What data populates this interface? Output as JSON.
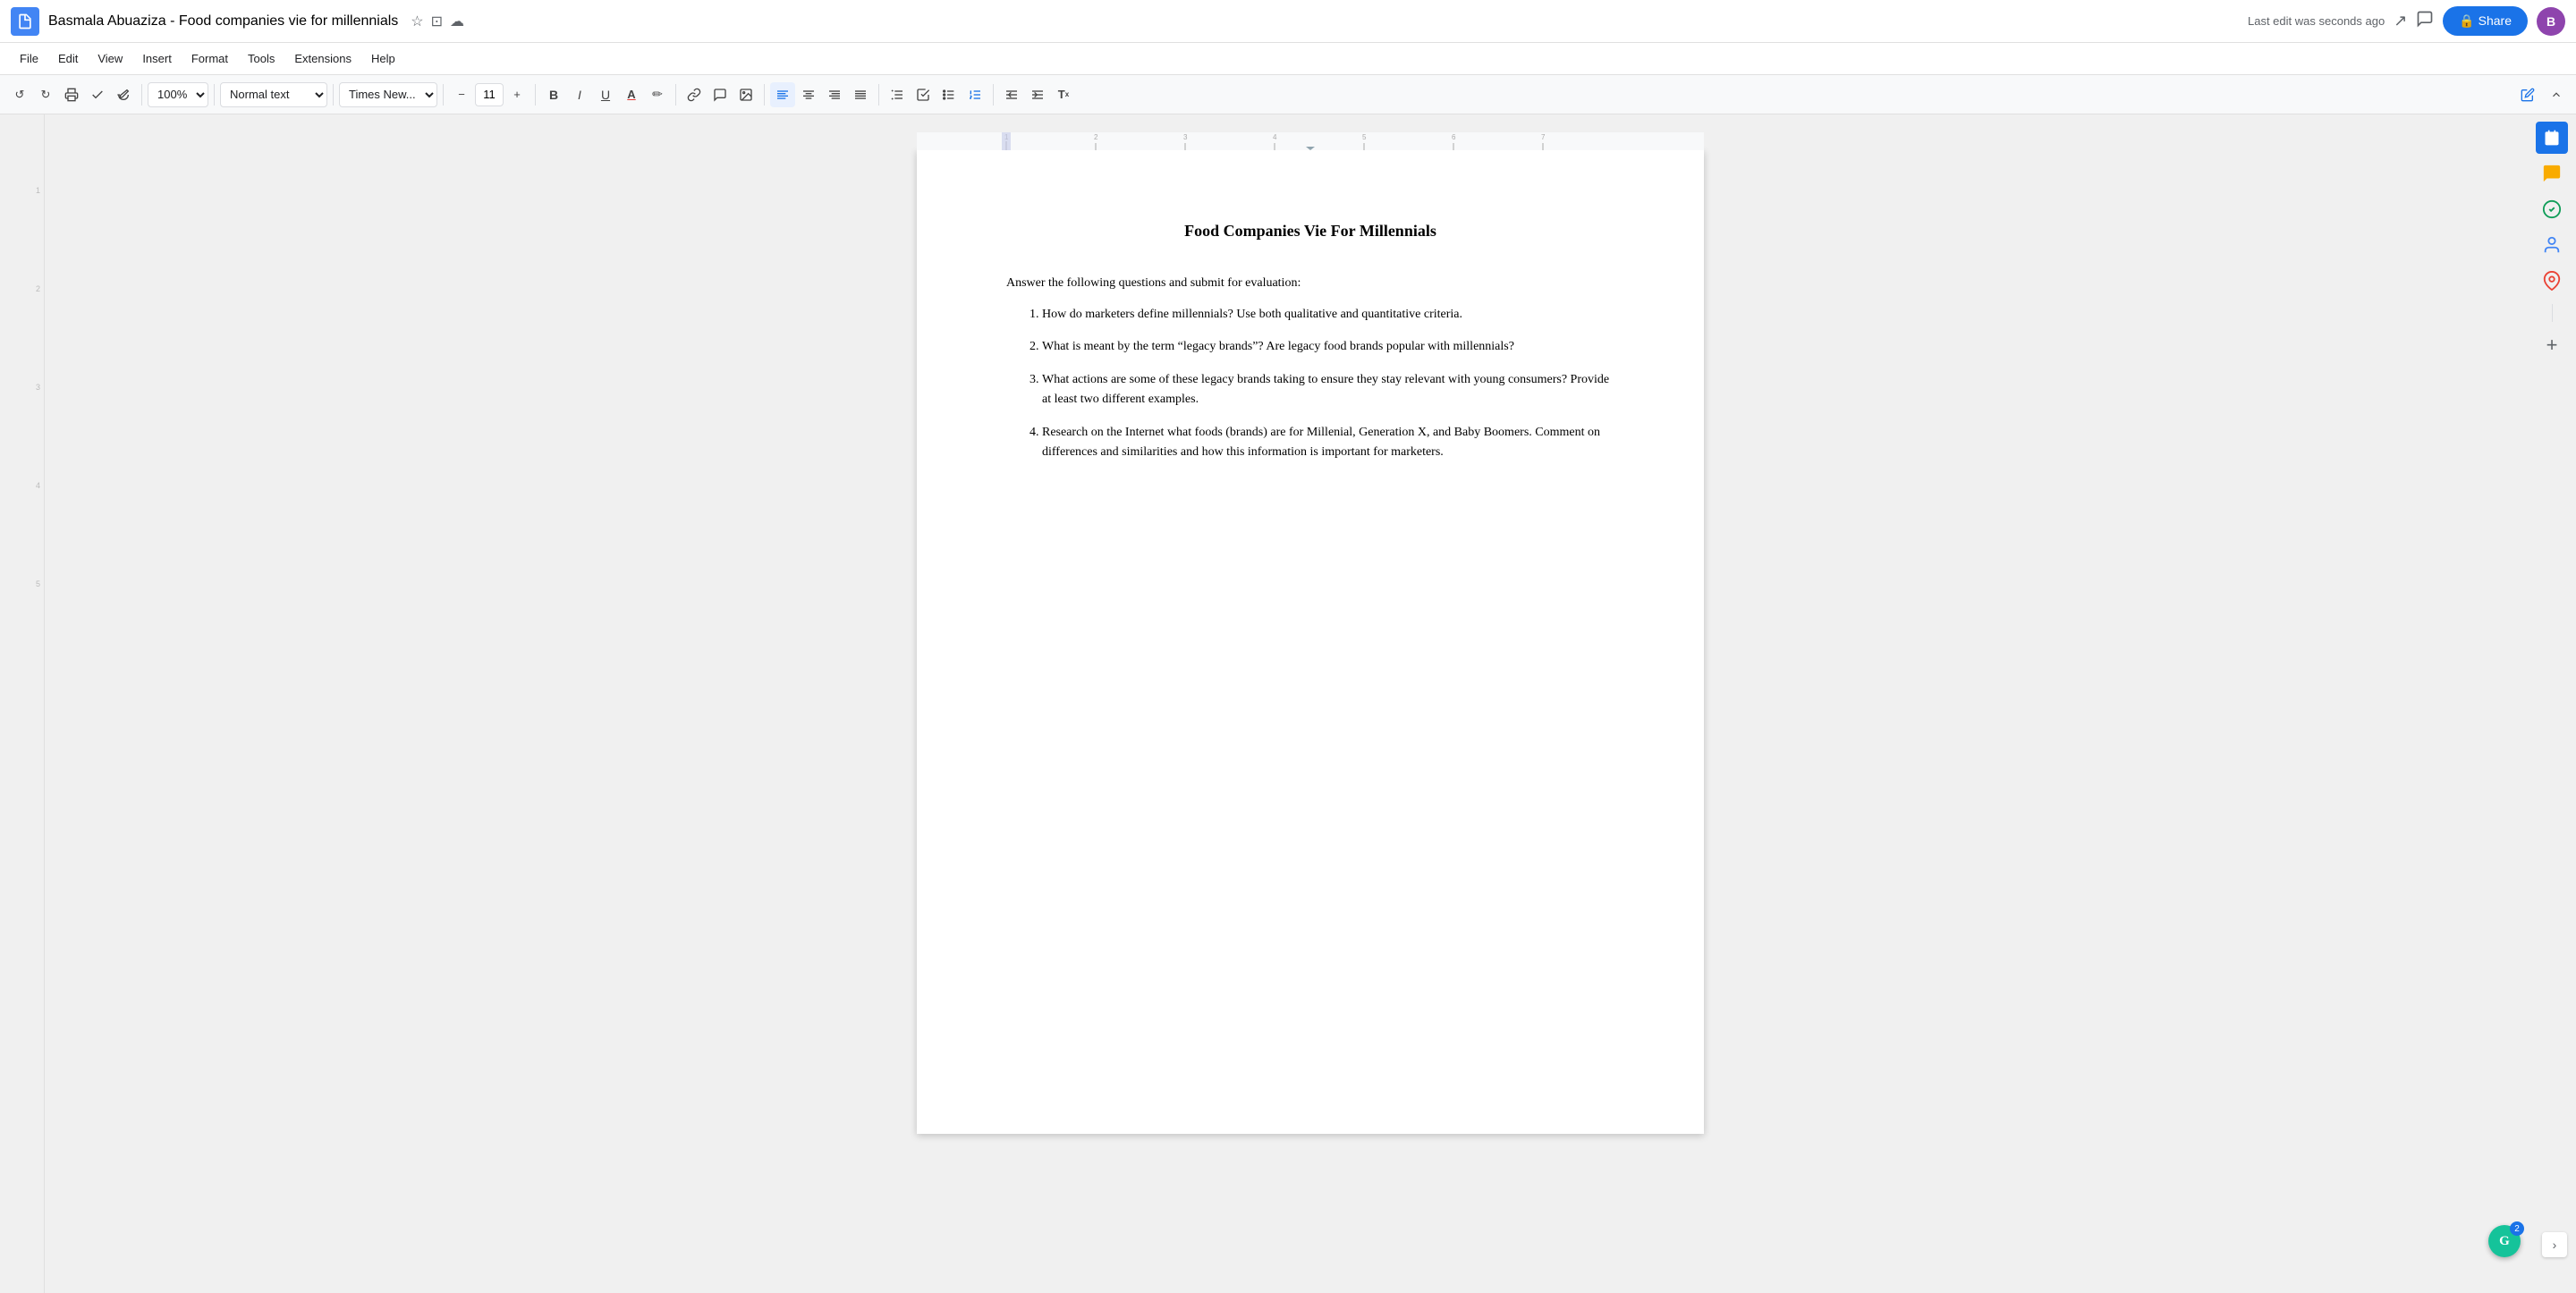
{
  "titleBar": {
    "appIconLabel": "📄",
    "docTitle": "Basmala Abuaziza - Food companies vie for millennials",
    "starIcon": "☆",
    "driveIcon": "⊡",
    "cloudIcon": "☁",
    "lastEdit": "Last edit was seconds ago",
    "trendingIcon": "↗",
    "commentIcon": "💬",
    "shareLabel": "🔒 Share",
    "avatarLabel": "B"
  },
  "menuBar": {
    "items": [
      "File",
      "Edit",
      "View",
      "Insert",
      "Format",
      "Tools",
      "Extensions",
      "Help"
    ]
  },
  "toolbar": {
    "undo": "↺",
    "redo": "↻",
    "print": "🖨",
    "spellcheck": "✓",
    "paintFormat": "🖌",
    "zoom": "100%",
    "zoomArrow": "▾",
    "styleLabel": "Normal text",
    "styleArrow": "▾",
    "fontLabel": "Times New...",
    "fontArrow": "▾",
    "fontSizeMinus": "−",
    "fontSize": "11",
    "fontSizePlus": "+",
    "bold": "B",
    "italic": "I",
    "underline": "U",
    "textColor": "A",
    "highlightColor": "✏",
    "link": "🔗",
    "comment": "💬",
    "image": "🖼",
    "alignLeft": "≡",
    "alignCenter": "≡",
    "alignRight": "≡",
    "alignJustify": "≡",
    "lineSpacing": "↕",
    "checklist": "☑",
    "bulletList": "•",
    "numberedList": "#",
    "decreaseIndent": "⇤",
    "increaseIndent": "⇥",
    "clearFormatting": "T"
  },
  "rightPanel": {
    "calendarIcon": "📅",
    "chatIcon": "💬",
    "checkIcon": "✓",
    "personIcon": "👤",
    "mapsIcon": "📍",
    "plusIcon": "+"
  },
  "document": {
    "title": "Food Companies Vie For Millennials",
    "intro": "Answer the following questions and submit for evaluation:",
    "listItems": [
      "How do marketers define millennials?  Use both qualitative and quantitative criteria.",
      "What is meant by the term “legacy brands”?  Are legacy food brands popular with millennials?",
      "What actions are some of these legacy brands taking to ensure they stay relevant with young consumers?  Provide at least two different examples.",
      "Research on the Internet what foods (brands) are for Millenial, Generation X, and Baby Boomers.  Comment on differences and similarities and how this information is important for marketers."
    ]
  },
  "grammarly": {
    "badge": "2",
    "icon": "G"
  }
}
